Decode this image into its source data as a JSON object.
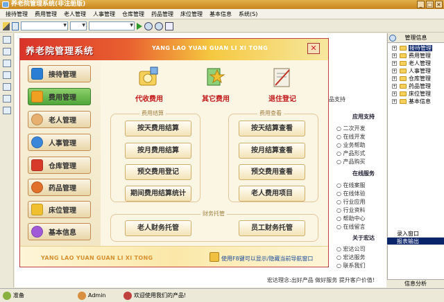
{
  "window": {
    "title": "养老院管理系统(非注册版)"
  },
  "menu": [
    "接待管理",
    "费用管理",
    "老人管理",
    "人事管理",
    "仓库管理",
    "药品管理",
    "床位管理",
    "基本信息",
    "系统(S)"
  ],
  "panel": {
    "title": "养老院管理系统",
    "subtitle": "YANG LAO YUAN GUAN LI XI TONG",
    "close": "✕",
    "nav": [
      {
        "label": "接待管理",
        "icon": "reception-icon",
        "color": "#2a7fd4"
      },
      {
        "label": "费用管理",
        "icon": "cost-icon",
        "color": "#f0a020",
        "active": true
      },
      {
        "label": "老人管理",
        "icon": "elder-icon",
        "color": "#e8b070"
      },
      {
        "label": "人事管理",
        "icon": "staff-icon",
        "color": "#3a86d8"
      },
      {
        "label": "仓库管理",
        "icon": "warehouse-icon",
        "color": "#d83a2a"
      },
      {
        "label": "药品管理",
        "icon": "medicine-icon",
        "color": "#e0702a"
      },
      {
        "label": "床位管理",
        "icon": "bed-icon",
        "color": "#f0c030"
      },
      {
        "label": "基本信息",
        "icon": "info-icon",
        "color": "#a05ad8"
      }
    ],
    "big": [
      "代收费用",
      "其它费用",
      "退住登记"
    ],
    "group1": {
      "label": "费用结算",
      "buttons": [
        "按天费用结算",
        "按月费用结算",
        "预交费用登记",
        "期间费用结算统计"
      ]
    },
    "group2": {
      "label": "费用查看",
      "buttons": [
        "按天结算查看",
        "按月结算查看",
        "预交费用查看",
        "老人费用项目"
      ]
    },
    "group3": {
      "label": "财务托管",
      "buttons": [
        "老人财务托管",
        "员工财务托管"
      ]
    },
    "footer_left": "YANG LAO YUAN GUAN LI XI TONG",
    "footer_right": "使用F8键可以显示/隐藏当前导航窗口"
  },
  "services": {
    "partial": "品支持",
    "app_head": "应用支持",
    "app_items": [
      "二次开发",
      "在线开发",
      "业务帮助",
      "产品形式",
      "产品购买"
    ],
    "online_head": "在线服务",
    "online_items": [
      "在线案服",
      "在线体验",
      "行业应用",
      "行业资料",
      "帮助中心",
      "在线留言"
    ],
    "about_head": "关于宏达",
    "about_items": [
      "宏达公司",
      "宏达服务",
      "联系我们"
    ],
    "footer": "宏达理念:出好产品 做好服务 提升客户价值!"
  },
  "right": {
    "header": "管理信息",
    "tree": [
      "接待管理",
      "费用管理",
      "老人管理",
      "人事管理",
      "仓库管理",
      "药品管理",
      "床位管理",
      "基本信息"
    ],
    "list": [
      "录入窗口",
      "报表输出"
    ],
    "bottom": "信息分析"
  },
  "status": {
    "state": "准备",
    "user": "Admin",
    "welcome": "欢迎使用我们的产品!"
  }
}
